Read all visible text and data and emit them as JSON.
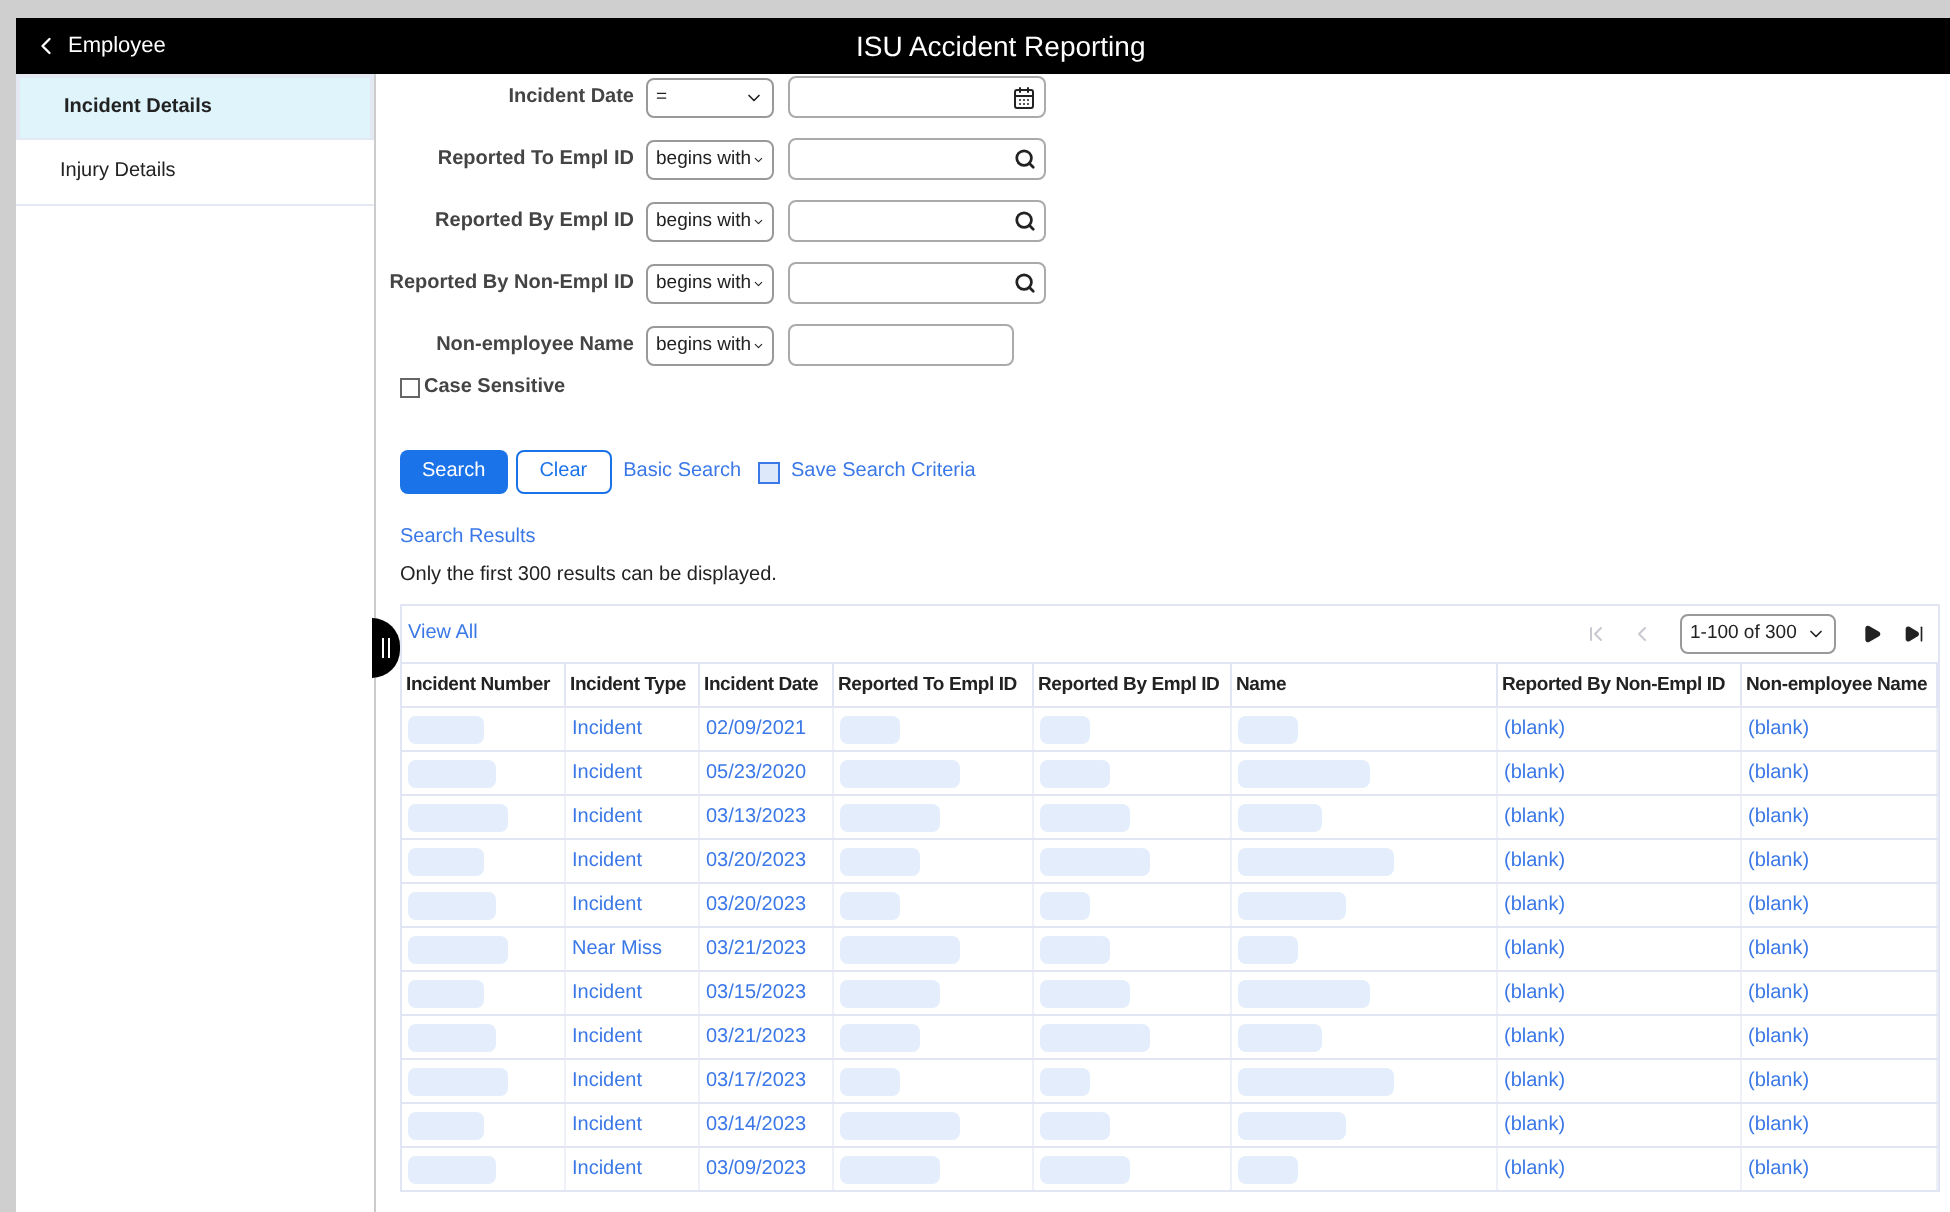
{
  "header": {
    "back_label": "Employee",
    "title": "ISU Accident Reporting"
  },
  "sidebar": {
    "items": [
      {
        "label": "Incident Details",
        "selected": true
      },
      {
        "label": "Injury Details",
        "selected": false
      }
    ]
  },
  "criteria": [
    {
      "label": "Incident Date",
      "operator": "=",
      "kind": "calendar"
    },
    {
      "label": "Reported To Empl ID",
      "operator": "begins with",
      "kind": "lookup"
    },
    {
      "label": "Reported By Empl ID",
      "operator": "begins with",
      "kind": "lookup"
    },
    {
      "label": "Reported By Non-Empl ID",
      "operator": "begins with",
      "kind": "lookup"
    },
    {
      "label": "Non-employee Name",
      "operator": "begins with",
      "kind": "plain"
    }
  ],
  "case_sensitive": {
    "label": "Case Sensitive",
    "checked": false
  },
  "actions": {
    "search": "Search",
    "clear": "Clear",
    "basic_search": "Basic Search",
    "save_criteria": "Save Search Criteria"
  },
  "results": {
    "title": "Search Results",
    "note": "Only the first 300 results can be displayed.",
    "view_all": "View All",
    "pager": {
      "range": "1-100 of 300",
      "buttons": [
        {
          "kind": "first",
          "disabled": true
        },
        {
          "kind": "prev",
          "disabled": true
        },
        {
          "kind": "next",
          "disabled": false
        },
        {
          "kind": "last",
          "disabled": false
        }
      ]
    },
    "columns": [
      "Incident Number",
      "Incident Type",
      "Incident Date",
      "Reported To Empl ID",
      "Reported By Empl ID",
      "Name",
      "Reported By Non-Empl ID",
      "Non-employee Name"
    ],
    "rows": [
      {
        "incident_type": "Incident",
        "incident_date": "02/09/2021",
        "reported_by_non_empl_id": "(blank)",
        "non_employee_name": "(blank)"
      },
      {
        "incident_type": "Incident",
        "incident_date": "05/23/2020",
        "reported_by_non_empl_id": "(blank)",
        "non_employee_name": "(blank)"
      },
      {
        "incident_type": "Incident",
        "incident_date": "03/13/2023",
        "reported_by_non_empl_id": "(blank)",
        "non_employee_name": "(blank)"
      },
      {
        "incident_type": "Incident",
        "incident_date": "03/20/2023",
        "reported_by_non_empl_id": "(blank)",
        "non_employee_name": "(blank)"
      },
      {
        "incident_type": "Incident",
        "incident_date": "03/20/2023",
        "reported_by_non_empl_id": "(blank)",
        "non_employee_name": "(blank)"
      },
      {
        "incident_type": "Near Miss",
        "incident_date": "03/21/2023",
        "reported_by_non_empl_id": "(blank)",
        "non_employee_name": "(blank)"
      },
      {
        "incident_type": "Incident",
        "incident_date": "03/15/2023",
        "reported_by_non_empl_id": "(blank)",
        "non_employee_name": "(blank)"
      },
      {
        "incident_type": "Incident",
        "incident_date": "03/21/2023",
        "reported_by_non_empl_id": "(blank)",
        "non_employee_name": "(blank)"
      },
      {
        "incident_type": "Incident",
        "incident_date": "03/17/2023",
        "reported_by_non_empl_id": "(blank)",
        "non_employee_name": "(blank)"
      },
      {
        "incident_type": "Incident",
        "incident_date": "03/14/2023",
        "reported_by_non_empl_id": "(blank)",
        "non_employee_name": "(blank)"
      },
      {
        "incident_type": "Incident",
        "incident_date": "03/09/2023",
        "reported_by_non_empl_id": "(blank)",
        "non_employee_name": "(blank)"
      }
    ]
  }
}
